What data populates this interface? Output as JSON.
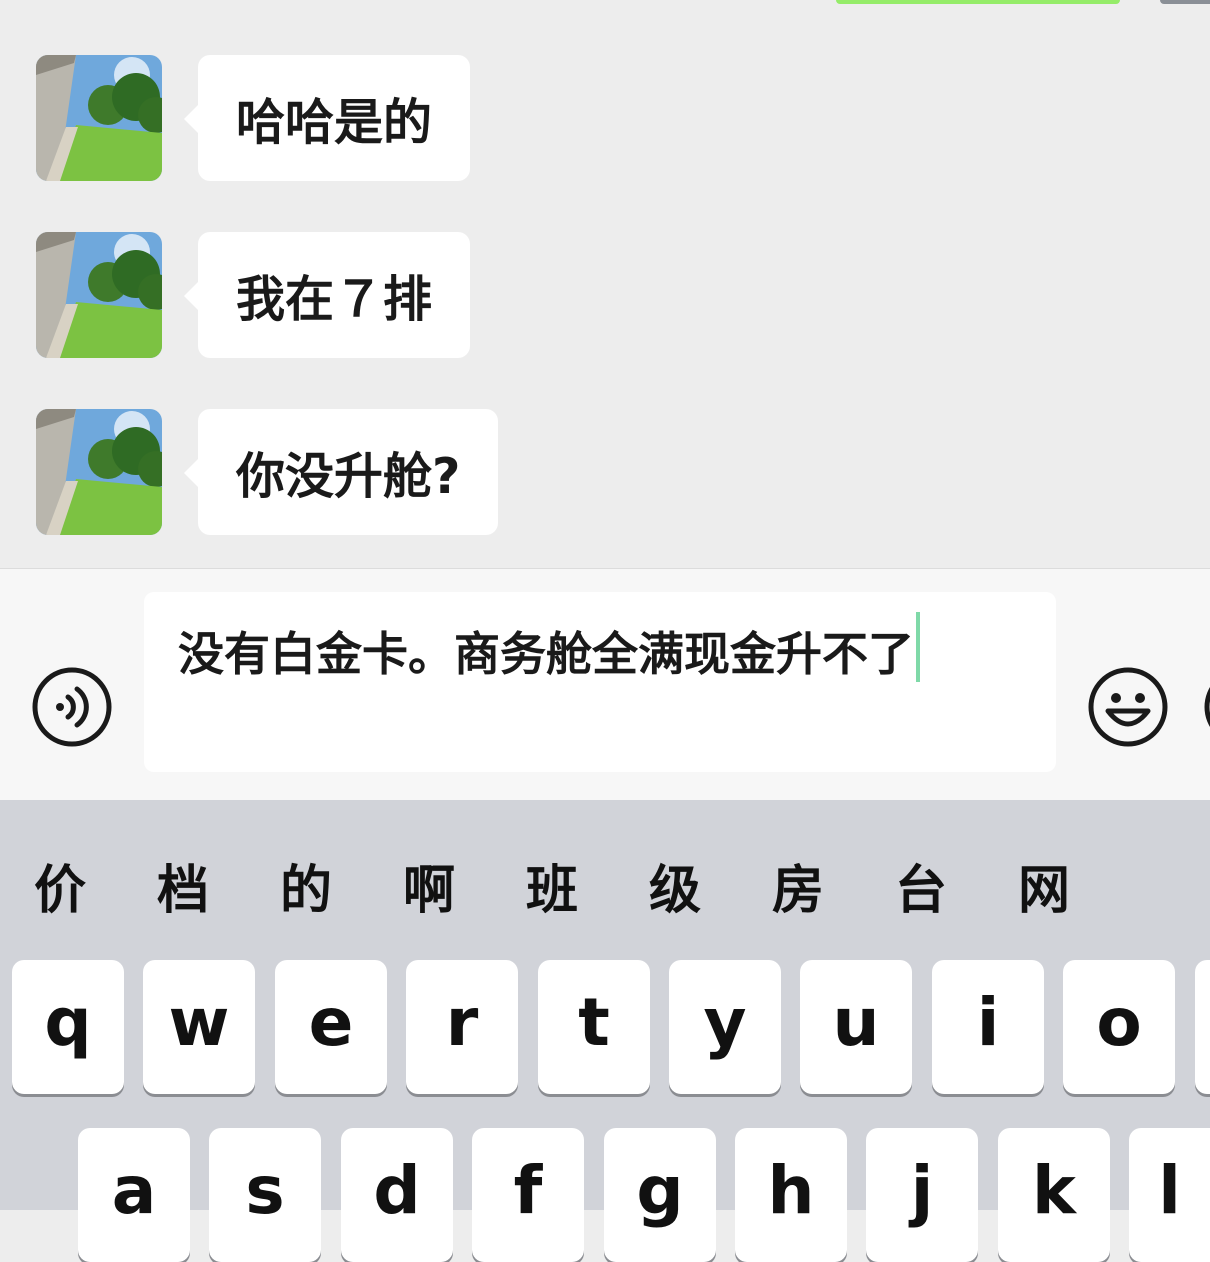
{
  "messages": [
    {
      "text": "哈哈是的"
    },
    {
      "text": "我在７排"
    },
    {
      "text": "你没升舱?"
    }
  ],
  "input": {
    "value": "没有白金卡。商务舱全满现金升不了"
  },
  "candidates": [
    "价",
    "档",
    "的",
    "啊",
    "班",
    "级",
    "房",
    "台",
    "网"
  ],
  "keyboard": {
    "row1": [
      "q",
      "w",
      "e",
      "r",
      "t",
      "y",
      "u",
      "i",
      "o"
    ],
    "row2": [
      "a",
      "s",
      "d",
      "f",
      "g",
      "h",
      "j",
      "k",
      "l"
    ]
  },
  "colors": {
    "chat_bg": "#ededed",
    "bubble": "#ffffff",
    "keyboard_bg": "#d1d3d9",
    "accent_green": "#95ec69",
    "caret": "#7fd9a8"
  },
  "icons": {
    "voice": "voice-icon",
    "emoji": "emoji-icon",
    "avatar": "avatar-photo"
  }
}
